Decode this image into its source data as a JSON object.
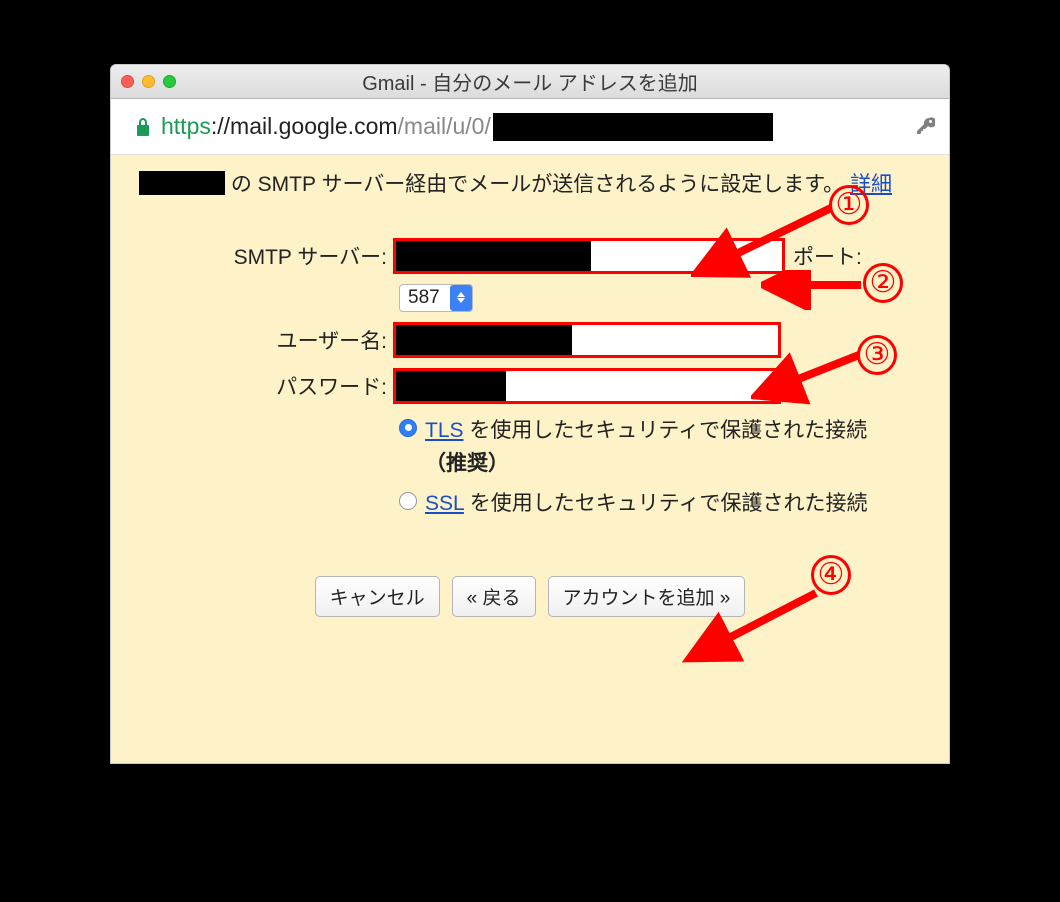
{
  "window": {
    "title": "Gmail - 自分のメール アドレスを追加"
  },
  "addressbar": {
    "protocol": "https",
    "host": "://mail.google.com",
    "path": "/mail/u/0/"
  },
  "intro": {
    "text_after_domain": "の SMTP サーバー経由でメールが送信されるように設定します。",
    "learn_more": "詳細"
  },
  "form": {
    "smtp_label": "SMTP サーバー:",
    "port_label": "ポート:",
    "port_value": "587",
    "username_label": "ユーザー名:",
    "password_label": "パスワード:"
  },
  "security": {
    "tls_link": "TLS",
    "tls_text": " を使用したセキュリティで保護された接続",
    "recommended": "（推奨）",
    "ssl_link": "SSL",
    "ssl_text": " を使用したセキュリティで保護された接続"
  },
  "buttons": {
    "cancel": "キャンセル",
    "back": "« 戻る",
    "add": "アカウントを追加 »"
  },
  "annotations": {
    "1": "①",
    "2": "②",
    "3": "③",
    "4": "④"
  }
}
